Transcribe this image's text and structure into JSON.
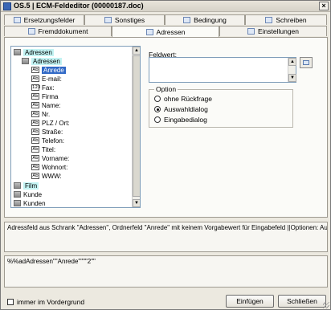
{
  "window": {
    "title": "OS.5 | ECM-Feldeditor (00000187.doc)",
    "close_label": "×"
  },
  "tabs_row1": [
    {
      "label": "Ersetzungsfelder"
    },
    {
      "label": "Sonstiges"
    },
    {
      "label": "Bedingung"
    },
    {
      "label": "Schreiben"
    }
  ],
  "tabs_row2": [
    {
      "label": "Fremddokument"
    },
    {
      "label": "Adressen"
    },
    {
      "label": "Einstellungen"
    }
  ],
  "tree": {
    "root": "Adressen",
    "group": "Adressen",
    "fields": [
      "Anrede",
      "E-mail:",
      "Fax:",
      "Firma",
      "Name:",
      "Nr.",
      "PLZ / Ort:",
      "Straße:",
      "Telefon:",
      "Titel:",
      "Vorname:",
      "Wohnort:",
      "WWW:"
    ],
    "field_icon_text": [
      "Ab",
      "Ab",
      "123",
      "Ab",
      "Ab",
      "Ab",
      "Ab",
      "Ab",
      "Ab",
      "Ab",
      "Ab",
      "Ab",
      "Ab"
    ],
    "others": [
      "Film",
      "Kunde",
      "Kunden"
    ],
    "scroll_up": "▲",
    "scroll_down": "▼"
  },
  "fieldvalue": {
    "label": "Feldwert:",
    "value": "",
    "scroll_up": "▲",
    "scroll_down": "▼"
  },
  "option": {
    "title": "Option",
    "items": [
      "ohne Rückfrage",
      "Auswahldialog",
      "Eingabedialog"
    ],
    "selected": "Auswahldialog"
  },
  "description": "Adressfeld aus Schrank \"Adressen\", Ordnerfeld \"Anrede\" mit keinem Vorgabewert für Eingabefeld ||Optionen: Auswahldialog",
  "code": "%%adAdressen\"\"Anrede\"\"\"\"2\"\"",
  "footer": {
    "checkbox_label": "immer im Vordergrund",
    "insert_label": "Einfügen",
    "close_label": "Schließen"
  }
}
